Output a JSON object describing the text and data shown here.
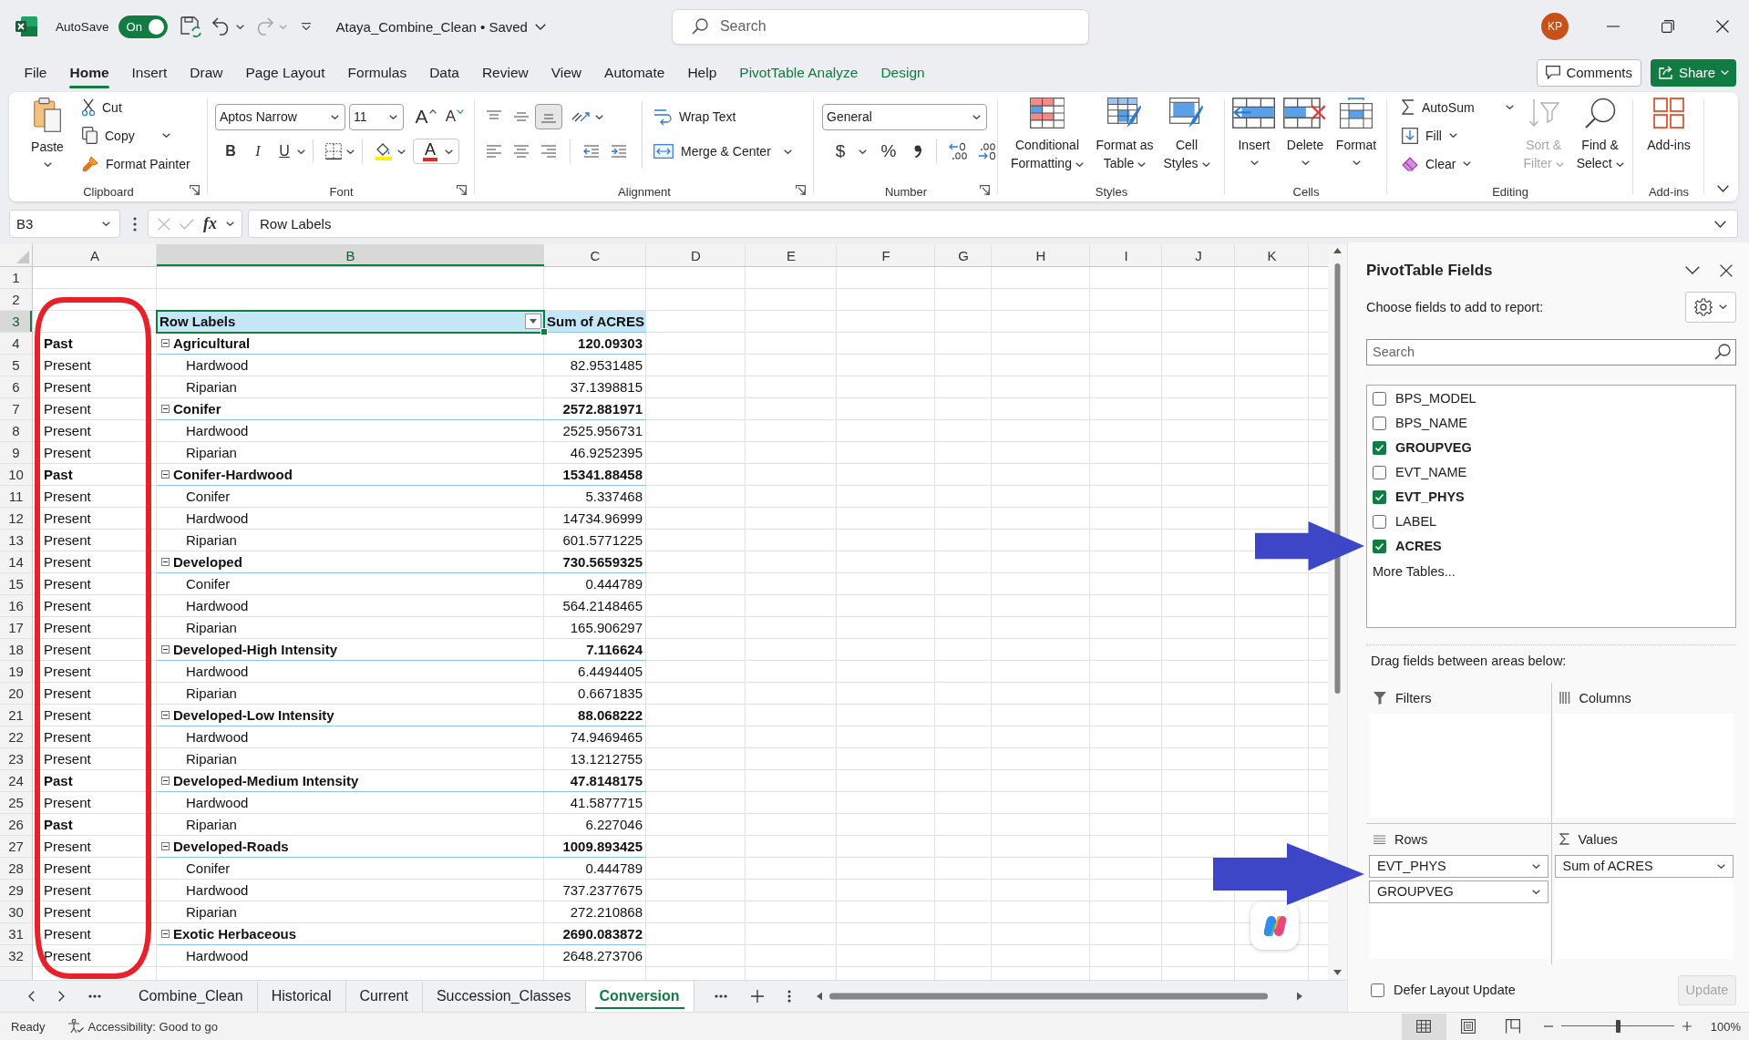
{
  "title_bar": {
    "autosave_label": "AutoSave",
    "autosave": {
      "label": "On",
      "on": true
    },
    "quick_access": [
      {
        "kind": "save",
        "disabled": false
      },
      {
        "kind": "undo",
        "disabled": false
      },
      {
        "kind": "redo",
        "disabled": true
      },
      {
        "kind": "customize",
        "disabled": false
      }
    ],
    "document": "Ataya_Combine_Clean • Saved",
    "search": {
      "placeholder": "Search"
    },
    "avatar": "KP"
  },
  "ribbon_tabs": [
    {
      "label": "File",
      "kind": "standard",
      "selected": false
    },
    {
      "label": "Home",
      "kind": "standard",
      "selected": true
    },
    {
      "label": "Insert",
      "kind": "standard",
      "selected": false
    },
    {
      "label": "Draw",
      "kind": "standard",
      "selected": false
    },
    {
      "label": "Page Layout",
      "kind": "standard",
      "selected": false
    },
    {
      "label": "Formulas",
      "kind": "standard",
      "selected": false
    },
    {
      "label": "Data",
      "kind": "standard",
      "selected": false
    },
    {
      "label": "Review",
      "kind": "standard",
      "selected": false
    },
    {
      "label": "View",
      "kind": "standard",
      "selected": false
    },
    {
      "label": "Automate",
      "kind": "standard",
      "selected": false
    },
    {
      "label": "Help",
      "kind": "standard",
      "selected": false
    },
    {
      "label": "PivotTable Analyze",
      "kind": "contextual",
      "selected": false
    },
    {
      "label": "Design",
      "kind": "contextual",
      "selected": false
    }
  ],
  "ribbon_actions": {
    "comments": "Comments",
    "share": "Share"
  },
  "ribbon": {
    "groups": [
      {
        "kind": "clipboard",
        "label": "Clipboard",
        "launcher": true,
        "paste": "Paste",
        "cut": "Cut",
        "copy": "Copy",
        "format_painter": "Format Painter"
      },
      {
        "kind": "font",
        "label": "Font",
        "launcher": true,
        "font_name": "Aptos Narrow",
        "font_size": "11",
        "grow": "A",
        "shrink": "A",
        "bold": "B",
        "italic": "I",
        "underline": "U",
        "font_color": "A"
      },
      {
        "kind": "alignment",
        "label": "Alignment",
        "launcher": true,
        "vertical_align": [
          {
            "kind": "top",
            "selected": false
          },
          {
            "kind": "middle",
            "selected": false
          },
          {
            "kind": "bottom",
            "selected": true
          }
        ],
        "wrap_text": "Wrap Text",
        "merge_center": "Merge & Center"
      },
      {
        "kind": "number",
        "label": "Number",
        "launcher": true,
        "format": "General",
        "currency": "$",
        "percent": "%"
      },
      {
        "kind": "large_buttons",
        "label": "Styles",
        "launcher": false,
        "buttons": [
          {
            "kind": "conditional_formatting",
            "label": "Conditional Formatting",
            "dropdown": true,
            "caret_below": false,
            "disabled": false
          },
          {
            "kind": "format_as_table",
            "label": "Format as Table",
            "dropdown": true,
            "caret_below": false,
            "disabled": false
          },
          {
            "kind": "cell_styles",
            "label": "Cell Styles",
            "dropdown": true,
            "caret_below": false,
            "disabled": false
          }
        ]
      },
      {
        "kind": "large_buttons",
        "label": "Cells",
        "launcher": false,
        "buttons": [
          {
            "kind": "insert",
            "label": "Insert",
            "dropdown": true,
            "caret_below": true,
            "disabled": false
          },
          {
            "kind": "delete",
            "label": "Delete",
            "dropdown": true,
            "caret_below": true,
            "disabled": false
          },
          {
            "kind": "format",
            "label": "Format",
            "dropdown": true,
            "caret_below": true,
            "disabled": false
          }
        ]
      },
      {
        "kind": "editing",
        "label": "Editing",
        "launcher": false,
        "small": [
          {
            "kind": "autosum",
            "label": "AutoSum"
          },
          {
            "kind": "fill",
            "label": "Fill"
          },
          {
            "kind": "clear",
            "label": "Clear"
          }
        ],
        "buttons": [
          {
            "kind": "sort_filter",
            "label": "Sort & Filter",
            "dropdown": true,
            "caret_below": false,
            "disabled": true
          },
          {
            "kind": "find_select",
            "label": "Find & Select",
            "dropdown": true,
            "caret_below": false,
            "disabled": false
          }
        ]
      },
      {
        "kind": "large_buttons",
        "label": "Add-ins",
        "launcher": false,
        "buttons": [
          {
            "kind": "addins",
            "label": "Add-ins",
            "dropdown": false,
            "disabled": false
          }
        ]
      }
    ]
  },
  "formula_bar": {
    "name_box": "B3",
    "function_label": "fx",
    "formula": "Row Labels"
  },
  "sheet": {
    "columns": [
      {
        "label": "A",
        "selected": false
      },
      {
        "label": "B",
        "selected": true
      },
      {
        "label": "C",
        "selected": false
      },
      {
        "label": "D",
        "selected": false
      },
      {
        "label": "E",
        "selected": false
      },
      {
        "label": "F",
        "selected": false
      },
      {
        "label": "G",
        "selected": false
      },
      {
        "label": "H",
        "selected": false
      },
      {
        "label": "I",
        "selected": false
      },
      {
        "label": "J",
        "selected": false
      },
      {
        "label": "K",
        "selected": false
      }
    ],
    "row_numbers": [
      {
        "label": "1",
        "selected": false
      },
      {
        "label": "2",
        "selected": false
      },
      {
        "label": "3",
        "selected": true
      },
      {
        "label": "4",
        "selected": false
      },
      {
        "label": "5",
        "selected": false
      },
      {
        "label": "6",
        "selected": false
      },
      {
        "label": "7",
        "selected": false
      },
      {
        "label": "8",
        "selected": false
      },
      {
        "label": "9",
        "selected": false
      },
      {
        "label": "10",
        "selected": false
      },
      {
        "label": "11",
        "selected": false
      },
      {
        "label": "12",
        "selected": false
      },
      {
        "label": "13",
        "selected": false
      },
      {
        "label": "14",
        "selected": false
      },
      {
        "label": "15",
        "selected": false
      },
      {
        "label": "16",
        "selected": false
      },
      {
        "label": "17",
        "selected": false
      },
      {
        "label": "18",
        "selected": false
      },
      {
        "label": "19",
        "selected": false
      },
      {
        "label": "20",
        "selected": false
      },
      {
        "label": "21",
        "selected": false
      },
      {
        "label": "22",
        "selected": false
      },
      {
        "label": "23",
        "selected": false
      },
      {
        "label": "24",
        "selected": false
      },
      {
        "label": "25",
        "selected": false
      },
      {
        "label": "26",
        "selected": false
      },
      {
        "label": "27",
        "selected": false
      },
      {
        "label": "28",
        "selected": false
      },
      {
        "label": "29",
        "selected": false
      },
      {
        "label": "30",
        "selected": false
      },
      {
        "label": "31",
        "selected": false
      },
      {
        "label": "32",
        "selected": false
      }
    ],
    "column_a": [
      {
        "text": "Past",
        "bold": true
      },
      {
        "text": "Present",
        "bold": false
      },
      {
        "text": "Present",
        "bold": false
      },
      {
        "text": "Present",
        "bold": false
      },
      {
        "text": "Present",
        "bold": false
      },
      {
        "text": "Present",
        "bold": false
      },
      {
        "text": "Past",
        "bold": true
      },
      {
        "text": "Present",
        "bold": false
      },
      {
        "text": "Present",
        "bold": false
      },
      {
        "text": "Present",
        "bold": false
      },
      {
        "text": "Present",
        "bold": false
      },
      {
        "text": "Present",
        "bold": false
      },
      {
        "text": "Present",
        "bold": false
      },
      {
        "text": "Present",
        "bold": false
      },
      {
        "text": "Present",
        "bold": false
      },
      {
        "text": "Present",
        "bold": false
      },
      {
        "text": "Present",
        "bold": false
      },
      {
        "text": "Present",
        "bold": false
      },
      {
        "text": "Present",
        "bold": false
      },
      {
        "text": "Present",
        "bold": false
      },
      {
        "text": "Past",
        "bold": true
      },
      {
        "text": "Present",
        "bold": false
      },
      {
        "text": "Past",
        "bold": true
      },
      {
        "text": "Present",
        "bold": false
      },
      {
        "text": "Present",
        "bold": false
      },
      {
        "text": "Present",
        "bold": false
      },
      {
        "text": "Present",
        "bold": false
      },
      {
        "text": "Present",
        "bold": false
      },
      {
        "text": "Present",
        "bold": false
      }
    ],
    "pivot": {
      "header": {
        "row_labels": "Row Labels",
        "value_heading": "Sum of ACRES"
      },
      "groups": [
        {
          "label": "Agricultural",
          "value": "120.09303",
          "expanded": true,
          "children": [
            {
              "label": "Hardwood",
              "value": "82.9531485"
            },
            {
              "label": "Riparian",
              "value": "37.1398815"
            }
          ]
        },
        {
          "label": "Conifer",
          "value": "2572.881971",
          "expanded": true,
          "children": [
            {
              "label": "Hardwood",
              "value": "2525.956731"
            },
            {
              "label": "Riparian",
              "value": "46.9252395"
            }
          ]
        },
        {
          "label": "Conifer-Hardwood",
          "value": "15341.88458",
          "expanded": true,
          "children": [
            {
              "label": "Conifer",
              "value": "5.337468"
            },
            {
              "label": "Hardwood",
              "value": "14734.96999"
            },
            {
              "label": "Riparian",
              "value": "601.5771225"
            }
          ]
        },
        {
          "label": "Developed",
          "value": "730.5659325",
          "expanded": true,
          "children": [
            {
              "label": "Conifer",
              "value": "0.444789"
            },
            {
              "label": "Hardwood",
              "value": "564.2148465"
            },
            {
              "label": "Riparian",
              "value": "165.906297"
            }
          ]
        },
        {
          "label": "Developed-High Intensity",
          "value": "7.116624",
          "expanded": true,
          "children": [
            {
              "label": "Hardwood",
              "value": "6.4494405"
            },
            {
              "label": "Riparian",
              "value": "0.6671835"
            }
          ]
        },
        {
          "label": "Developed-Low Intensity",
          "value": "88.068222",
          "expanded": true,
          "children": [
            {
              "label": "Hardwood",
              "value": "74.9469465"
            },
            {
              "label": "Riparian",
              "value": "13.1212755"
            }
          ]
        },
        {
          "label": "Developed-Medium Intensity",
          "value": "47.8148175",
          "expanded": true,
          "children": [
            {
              "label": "Hardwood",
              "value": "41.5877715"
            },
            {
              "label": "Riparian",
              "value": "6.227046"
            }
          ]
        },
        {
          "label": "Developed-Roads",
          "value": "1009.893425",
          "expanded": true,
          "children": [
            {
              "label": "Conifer",
              "value": "0.444789"
            },
            {
              "label": "Hardwood",
              "value": "737.2377675"
            },
            {
              "label": "Riparian",
              "value": "272.210868"
            }
          ]
        },
        {
          "label": "Exotic Herbaceous",
          "value": "2690.083872",
          "expanded": true,
          "children": [
            {
              "label": "Hardwood",
              "value": "2648.273706"
            }
          ]
        }
      ]
    }
  },
  "sheet_tabs": [
    {
      "label": "Combine_Clean",
      "selected": false
    },
    {
      "label": "Historical",
      "selected": false
    },
    {
      "label": "Current",
      "selected": false
    },
    {
      "label": "Succession_Classes",
      "selected": false
    },
    {
      "label": "Conversion",
      "selected": true
    }
  ],
  "pivot_fields": {
    "title": "PivotTable Fields",
    "instruction": "Choose fields to add to report:",
    "search": {
      "placeholder": "Search"
    },
    "fields": [
      {
        "label": "BPS_MODEL",
        "checked": false
      },
      {
        "label": "BPS_NAME",
        "checked": false
      },
      {
        "label": "GROUPVEG",
        "checked": true
      },
      {
        "label": "EVT_NAME",
        "checked": false
      },
      {
        "label": "EVT_PHYS",
        "checked": true
      },
      {
        "label": "LABEL",
        "checked": false
      },
      {
        "label": "ACRES",
        "checked": true
      }
    ],
    "more_tables": "More Tables...",
    "areas_hint": "Drag fields between areas below:",
    "areas": [
      {
        "kind": "filters",
        "label": "Filters"
      },
      {
        "kind": "columns",
        "label": "Columns"
      },
      {
        "kind": "rows",
        "label": "Rows",
        "items": [
          "EVT_PHYS",
          "GROUPVEG"
        ]
      },
      {
        "kind": "values",
        "label": "Values",
        "items": [
          "Sum of ACRES"
        ]
      }
    ],
    "defer_update": {
      "label": "Defer Layout Update",
      "checked": false
    },
    "update_button": {
      "label": "Update",
      "disabled": true
    }
  },
  "status_bar": {
    "mode": "Ready",
    "accessibility": "Accessibility: Good to go",
    "views": [
      {
        "kind": "normal",
        "selected": true
      },
      {
        "kind": "page_layout",
        "selected": false
      },
      {
        "kind": "page_break",
        "selected": false
      }
    ],
    "zoom": {
      "level": 0.5,
      "reading": "100%"
    }
  },
  "annotations": [
    {
      "kind": "outline",
      "color": "#e8202a"
    },
    {
      "kind": "arrow",
      "color": "#3e46c8"
    },
    {
      "kind": "arrow",
      "color": "#3e46c8"
    }
  ]
}
